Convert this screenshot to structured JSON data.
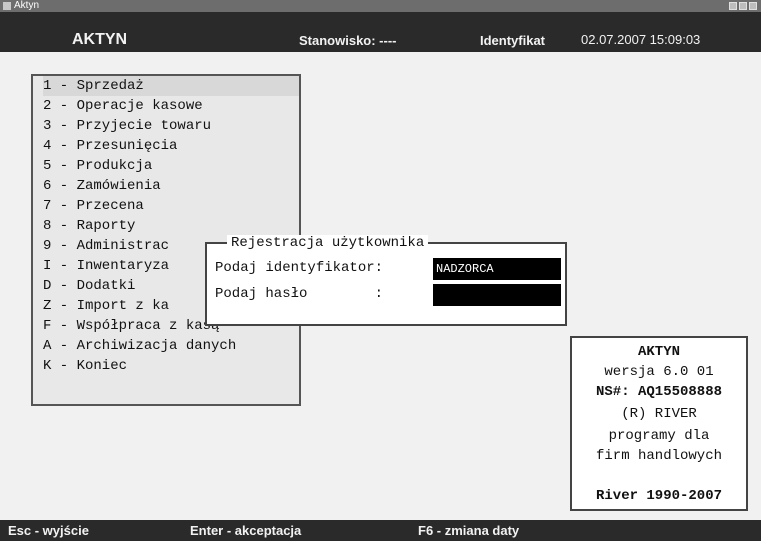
{
  "window": {
    "title": "Aktyn"
  },
  "header": {
    "app_name": "AKTYN",
    "station": "Stanowisko: ----",
    "identifier_label": "Identyfikat",
    "datetime": "02.07.2007 15:09:03"
  },
  "menu": {
    "items": [
      {
        "label": "1 - Sprzedaż"
      },
      {
        "label": "2 - Operacje kasowe"
      },
      {
        "label": "3 - Przyjecie towaru"
      },
      {
        "label": "4 - Przesunięcia"
      },
      {
        "label": "5 - Produkcja"
      },
      {
        "label": "6 - Zamówienia"
      },
      {
        "label": "7 - Przecena"
      },
      {
        "label": "8 - Raporty"
      },
      {
        "label": "9 - Administrac"
      },
      {
        "label": "I - Inwentaryza"
      },
      {
        "label": "D - Dodatki"
      },
      {
        "label": "Z - Import z ka"
      },
      {
        "label": "F - Współpraca z kasą"
      },
      {
        "label": "A - Archiwizacja danych"
      },
      {
        "label": "K - Koniec"
      }
    ]
  },
  "dialog": {
    "title": "Rejestracja użytkownika",
    "id_label": "Podaj identyfikator:",
    "id_value": "NADZORCA",
    "pass_label": "Podaj hasło        :",
    "pass_value": ""
  },
  "info": {
    "lines": [
      "AKTYN",
      "wersja 6.0 01",
      "NS#: AQ15508888",
      "(R) RIVER",
      "programy dla",
      "firm handlowych",
      "",
      "River 1990-2007"
    ]
  },
  "footer": {
    "esc": "Esc - wyjście",
    "enter": "Enter - akceptacja",
    "f6": "F6 - zmiana daty"
  }
}
